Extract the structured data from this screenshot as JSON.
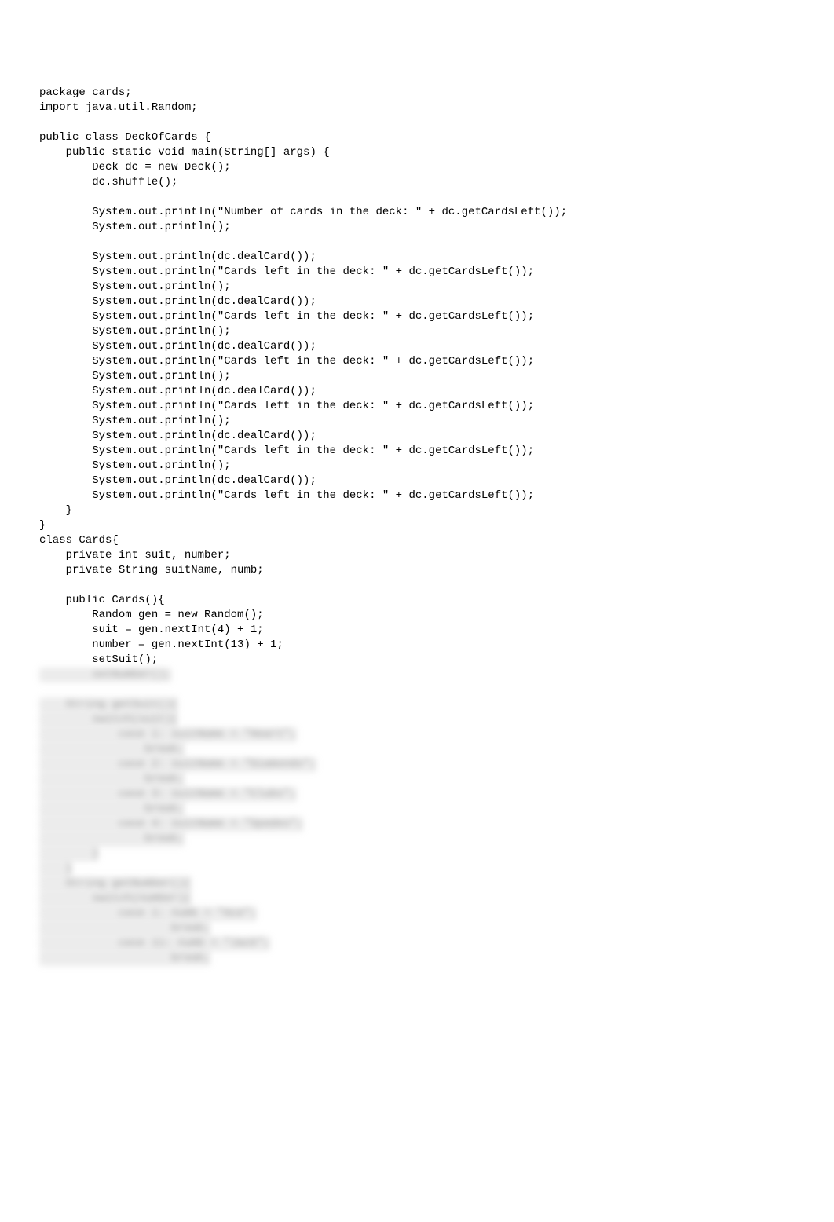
{
  "code": {
    "lines": [
      "package cards;",
      "import java.util.Random;",
      "",
      "public class DeckOfCards {",
      "    public static void main(String[] args) {",
      "        Deck dc = new Deck();",
      "        dc.shuffle();",
      "",
      "        System.out.println(\"Number of cards in the deck: \" + dc.getCardsLeft());",
      "        System.out.println();",
      "",
      "        System.out.println(dc.dealCard());",
      "        System.out.println(\"Cards left in the deck: \" + dc.getCardsLeft());",
      "        System.out.println();",
      "        System.out.println(dc.dealCard());",
      "        System.out.println(\"Cards left in the deck: \" + dc.getCardsLeft());",
      "        System.out.println();",
      "        System.out.println(dc.dealCard());",
      "        System.out.println(\"Cards left in the deck: \" + dc.getCardsLeft());",
      "        System.out.println();",
      "        System.out.println(dc.dealCard());",
      "        System.out.println(\"Cards left in the deck: \" + dc.getCardsLeft());",
      "        System.out.println();",
      "        System.out.println(dc.dealCard());",
      "        System.out.println(\"Cards left in the deck: \" + dc.getCardsLeft());",
      "        System.out.println();",
      "        System.out.println(dc.dealCard());",
      "        System.out.println(\"Cards left in the deck: \" + dc.getCardsLeft());",
      "    }",
      "}",
      "class Cards{",
      "    private int suit, number;",
      "    private String suitName, numb;",
      "",
      "    public Cards(){",
      "        Random gen = new Random();",
      "        suit = gen.nextInt(4) + 1;",
      "        number = gen.nextInt(13) + 1;",
      "        setSuit();"
    ]
  },
  "blurred": {
    "lines": [
      "        setNumber();",
      "",
      "    String getSuit(){",
      "        switch(suit){",
      "            case 1: suitName = \"Heart\";",
      "                break;",
      "            case 2: suitName = \"Diamonds\";",
      "                break;",
      "            case 3: suitName = \"Clubs\";",
      "                break;",
      "            case 4: suitName = \"Spades\";",
      "                break;",
      "        }",
      "    }",
      "    String getNumber(){",
      "        switch(number){",
      "            case 1: numb = \"Ace\";",
      "                    break;",
      "            case 11: numb = \"Jack\";",
      "                    break;"
    ]
  }
}
